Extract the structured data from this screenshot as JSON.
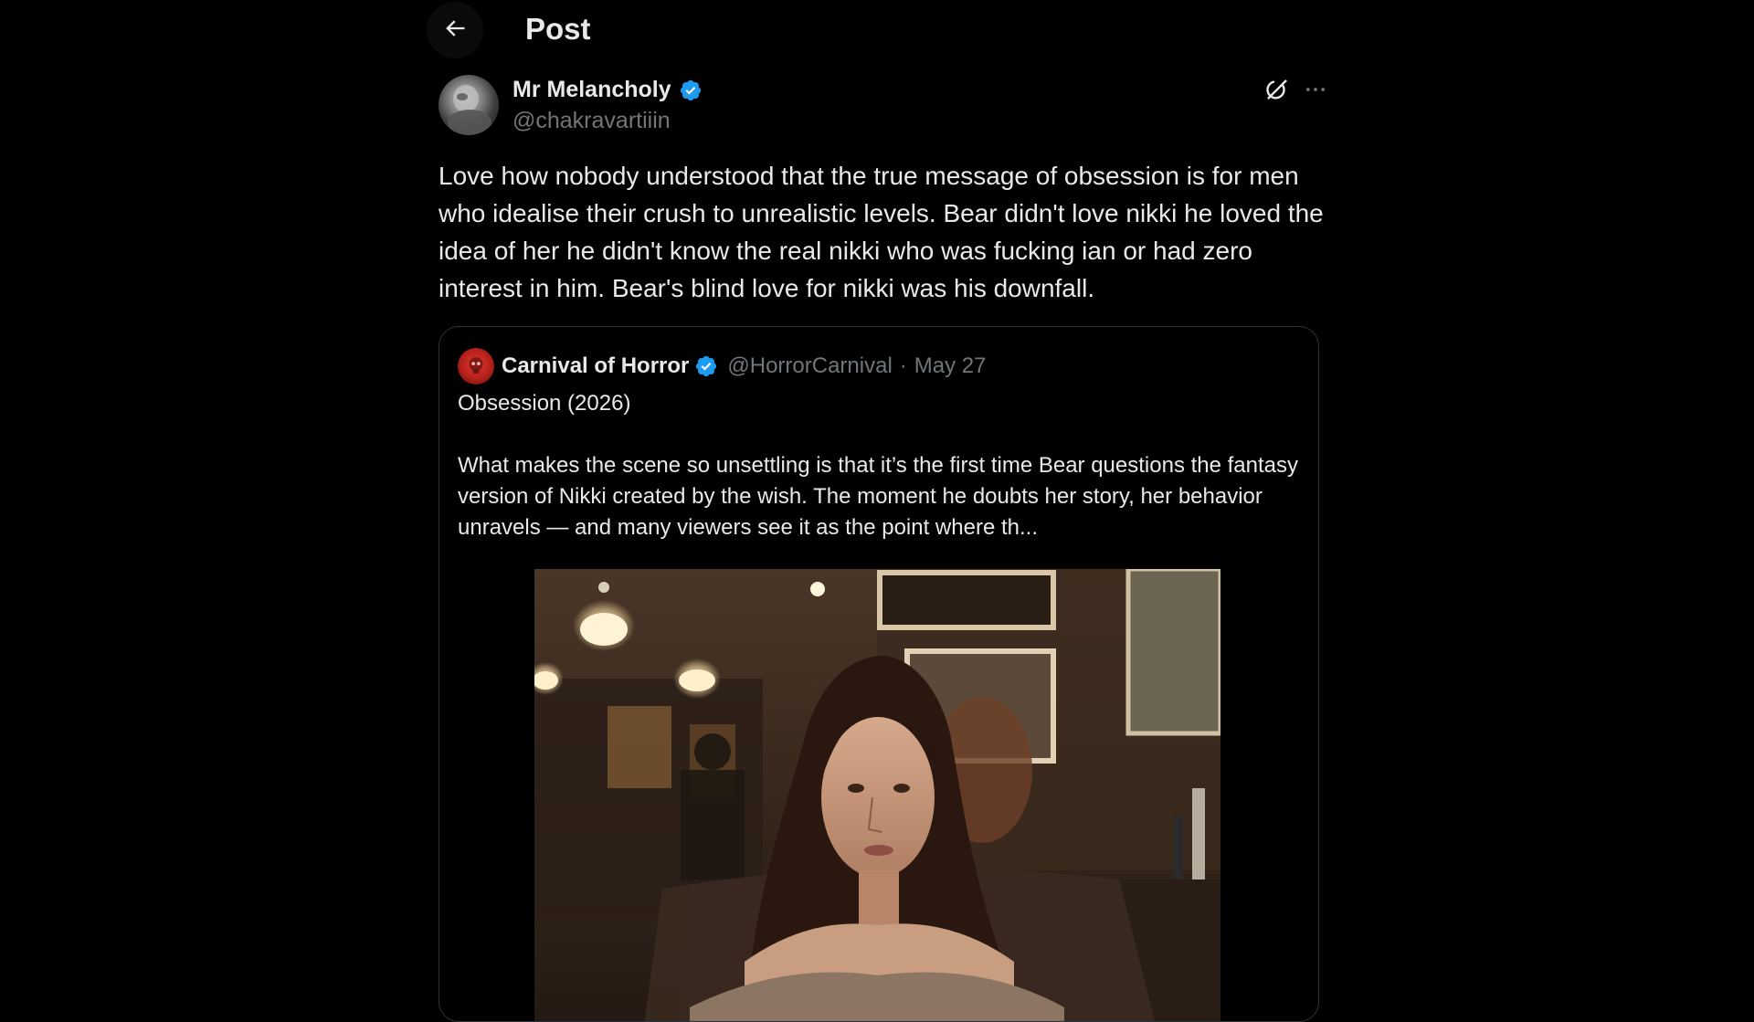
{
  "header": {
    "title": "Post",
    "back_icon": "arrow-left-icon"
  },
  "post": {
    "author_name": "Mr Melancholy",
    "author_handle": "@chakravartiiin",
    "verified": true,
    "text": "Love how nobody understood that the true message of obsession is for men who idealise their crush to unrealistic levels. Bear didn't love nikki he loved the idea of her he didn't know the real nikki who was fucking ian or had zero interest in him. Bear's blind love for nikki was his downfall.",
    "actions": [
      "grok-icon",
      "more-icon"
    ]
  },
  "quote": {
    "author_name": "Carnival of Horror",
    "author_handle": "@HorrorCarnival",
    "separator": "·",
    "date": "May 27",
    "verified": true,
    "title": "Obsession (2026)",
    "body": "What makes the scene so unsettling is that it’s the first time Bear questions the fantasy version of Nikki created by the wish. The moment he doubts her story, her behavior unravels — and many viewers see it as the point where th..."
  },
  "colors": {
    "background": "#000000",
    "text": "#e7e9ea",
    "secondary": "#71767b",
    "verified_blue": "#1d9bf0",
    "border": "#2f3336"
  }
}
